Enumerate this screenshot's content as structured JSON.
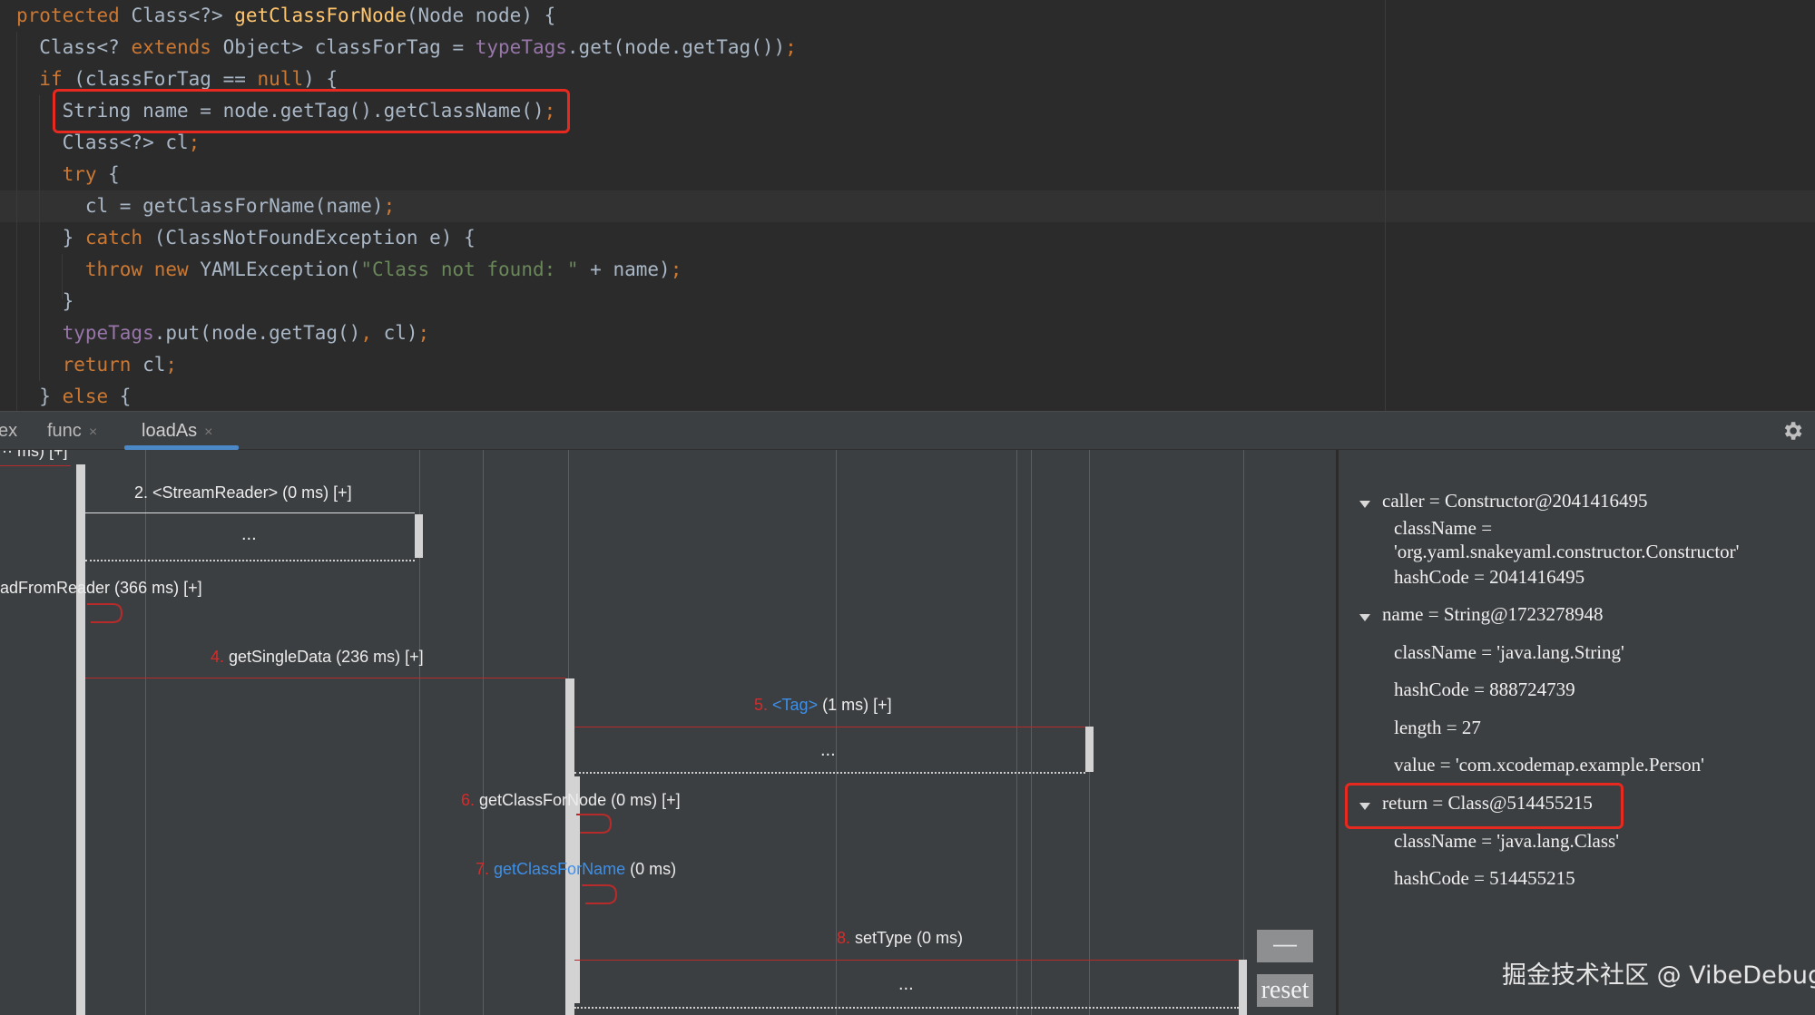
{
  "editor": {
    "lines": [
      [
        {
          "t": "protected ",
          "c": "kw"
        },
        {
          "t": "Class<?> "
        },
        {
          "t": "getClassForNode",
          "c": "fn"
        },
        {
          "t": "(Node node) {"
        }
      ],
      [
        {
          "t": "  Class<? "
        },
        {
          "t": "extends ",
          "c": "kw"
        },
        {
          "t": "Object> classForTag = "
        },
        {
          "t": "typeTags",
          "c": "fld"
        },
        {
          "t": ".get(node.getTag())"
        },
        {
          "t": ";",
          "c": "kw"
        }
      ],
      [
        {
          "t": "  "
        },
        {
          "t": "if ",
          "c": "kw"
        },
        {
          "t": "(classForTag == "
        },
        {
          "t": "null",
          "c": "kw"
        },
        {
          "t": ") {"
        }
      ],
      [
        {
          "t": "    String name = node.getTag().getClassName()"
        },
        {
          "t": ";",
          "c": "kw"
        }
      ],
      [
        {
          "t": "    Class<?> cl"
        },
        {
          "t": ";",
          "c": "kw"
        }
      ],
      [
        {
          "t": "    "
        },
        {
          "t": "try ",
          "c": "kw"
        },
        {
          "t": "{"
        }
      ],
      [
        {
          "t": "      cl = getClassForName(name)"
        },
        {
          "t": ";",
          "c": "kw"
        }
      ],
      [
        {
          "t": "    } "
        },
        {
          "t": "catch ",
          "c": "kw"
        },
        {
          "t": "(ClassNotFoundException e) {"
        }
      ],
      [
        {
          "t": "      "
        },
        {
          "t": "throw new ",
          "c": "kw"
        },
        {
          "t": "YAMLException("
        },
        {
          "t": "\"Class not found: \"",
          "c": "str"
        },
        {
          "t": " + name)"
        },
        {
          "t": ";",
          "c": "kw"
        }
      ],
      [
        {
          "t": "    }"
        }
      ],
      [
        {
          "t": "    "
        },
        {
          "t": "typeTags",
          "c": "fld"
        },
        {
          "t": ".put(node.getTag()"
        },
        {
          "t": ", ",
          "c": "kw"
        },
        {
          "t": "cl)"
        },
        {
          "t": ";",
          "c": "kw"
        }
      ],
      [
        {
          "t": "    "
        },
        {
          "t": "return ",
          "c": "kw"
        },
        {
          "t": "cl"
        },
        {
          "t": ";",
          "c": "kw"
        }
      ],
      [
        {
          "t": "  } "
        },
        {
          "t": "else ",
          "c": "kw"
        },
        {
          "t": "{"
        }
      ]
    ]
  },
  "tabs": {
    "partial": "ex",
    "items": [
      {
        "label": "func",
        "close": "×"
      },
      {
        "label": "loadAs",
        "close": "×"
      }
    ]
  },
  "diagram": {
    "top_partial_label": "··· ms) [+]",
    "messages": {
      "m2": {
        "num": "",
        "label": "2. <StreamReader> (0 ms) [+]"
      },
      "m3": {
        "label": "adFromReader (366 ms) [+]"
      },
      "m4": {
        "num": "4.",
        "label": " getSingleData (236 ms) [+]"
      },
      "m5": {
        "num": "5.",
        "link": "<Tag>",
        "label": " (1 ms) [+]"
      },
      "m6": {
        "num": "6.",
        "label": " getClassForNode (0 ms) [+]"
      },
      "m7": {
        "num": "7.",
        "link": "getClassForName",
        "label": " (0 ms)"
      },
      "m8": {
        "num": "8.",
        "label": " setType (0 ms)"
      }
    },
    "ellipsis": "...",
    "buttons": {
      "minus": "—",
      "reset": "reset"
    }
  },
  "variables": {
    "caller": "caller = Constructor@2041416495",
    "caller_className": "className = 'org.yaml.snakeyaml.constructor.Constructor'",
    "caller_hashCode": "hashCode = 2041416495",
    "name": "name = String@1723278948",
    "name_className": "className = 'java.lang.String'",
    "name_hashCode": "hashCode = 888724739",
    "name_length": "length = 27",
    "name_value": "value = 'com.xcodemap.example.Person'",
    "ret": "return = Class@514455215",
    "ret_className": "className = 'java.lang.Class'",
    "ret_hashCode": "hashCode = 514455215"
  },
  "watermark": "掘金技术社区 @ VibeDebug",
  "colors": {
    "highlight": "#e8291f",
    "link": "#3d8fe8",
    "step_number": "#d62b2b"
  }
}
